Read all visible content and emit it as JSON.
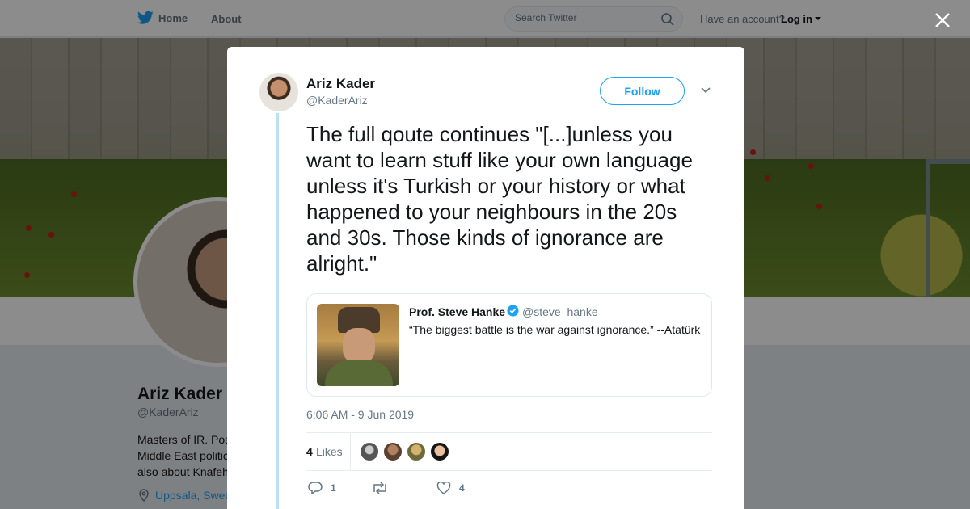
{
  "nav": {
    "home_label": "Home",
    "about_label": "About",
    "search_placeholder": "Search Twitter",
    "have_account": "Have an account?",
    "login_label": "Log in"
  },
  "profile": {
    "name": "Ariz Kader",
    "handle": "@KaderAriz",
    "bio_lines": [
      "Masters of IR. Pos",
      "Middle East politic",
      "also about Knafeh"
    ],
    "location": "Uppsala, Swed"
  },
  "tweet": {
    "author_name": "Ariz Kader",
    "author_handle": "@KaderAriz",
    "follow_label": "Follow",
    "text": "The full qoute continues \"[...]unless you want to learn stuff like your own language unless it's Turkish or your history or what happened to your neighbours in the 20s and 30s. Those kinds of ignorance are alright.\"",
    "timestamp": "6:06 AM - 9 Jun 2019",
    "likes_count": "4",
    "likes_label": "Likes",
    "reply_count": "1",
    "like_action_count": "4"
  },
  "quote": {
    "name": "Prof. Steve Hanke",
    "handle": "@steve_hanke",
    "text": "“The biggest battle is the war against ignorance.” --Atatürk"
  },
  "colors": {
    "brand": "#1da1f2",
    "muted": "#657786",
    "thread_line": "#bde0f5"
  }
}
